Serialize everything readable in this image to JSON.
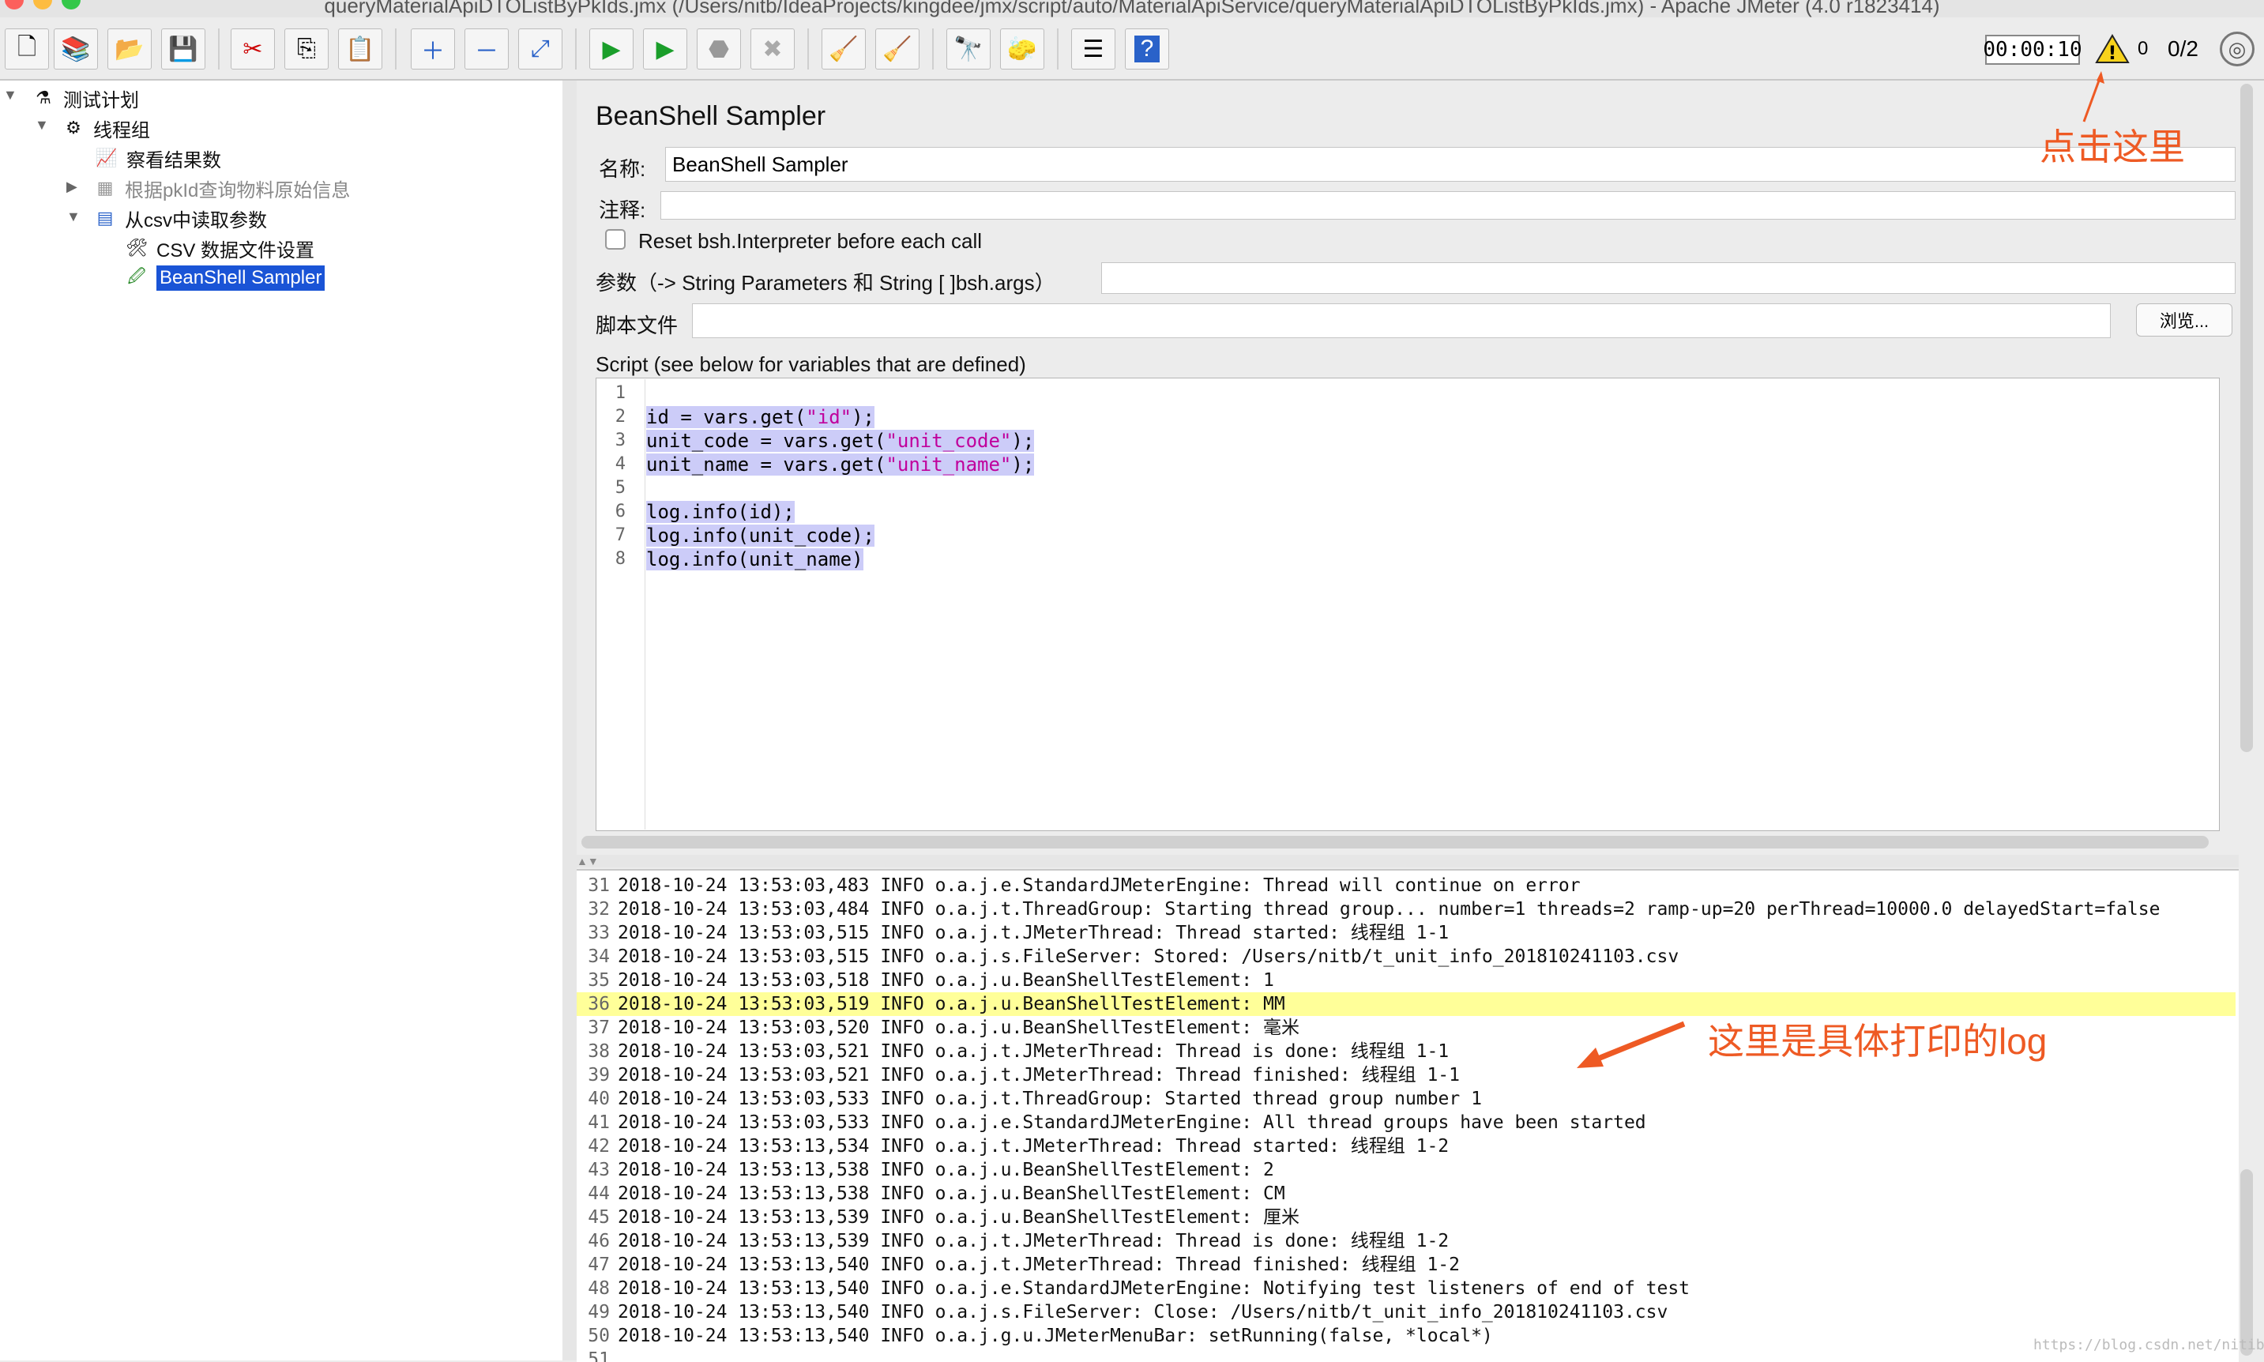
{
  "window": {
    "title": "queryMaterialApiDTOListByPkIds.jmx (/Users/nitb/IdeaProjects/kingdee/jmx/script/auto/MaterialApiService/queryMaterialApiDTOListByPkIds.jmx) - Apache JMeter (4.0 r1823414)"
  },
  "toolbar": {
    "timer": "00:00:10",
    "error_count": "0",
    "thread_count": "0/2"
  },
  "tree": {
    "items": [
      {
        "label": "测试计划"
      },
      {
        "label": "线程组"
      },
      {
        "label": "察看结果数"
      },
      {
        "label": "根据pkId查询物料原始信息"
      },
      {
        "label": "从csv中读取参数"
      },
      {
        "label": "CSV 数据文件设置"
      },
      {
        "label": "BeanShell Sampler"
      }
    ]
  },
  "panel": {
    "heading": "BeanShell Sampler",
    "name_label": "名称:",
    "name_value": "BeanShell Sampler",
    "comment_label": "注释:",
    "reset_label": "Reset bsh.Interpreter before each call",
    "params_label": "参数（-> String Parameters 和 String [ ]bsh.args）",
    "script_file_label": "脚本文件",
    "browse_label": "浏览...",
    "script_label": "Script (see below for variables that are defined)"
  },
  "script": {
    "line_numbers": [
      "1",
      "2",
      "3",
      "4",
      "5",
      "6",
      "7",
      "8"
    ],
    "l2a": "id = vars.get(",
    "l2s": "\"id\"",
    "l2b": ");",
    "l3a": "unit_code = vars.get(",
    "l3s": "\"unit_code\"",
    "l3b": ");",
    "l4a": "unit_name = vars.get(",
    "l4s": "\"unit_name\"",
    "l4b": ");",
    "l6": "log.info(id);",
    "l7": "log.info(unit_code);",
    "l8": "log.info(unit_name)"
  },
  "log": {
    "rows": [
      {
        "n": "31",
        "text": "2018-10-24 13:53:03,483 INFO o.a.j.e.StandardJMeterEngine: Thread will continue on error"
      },
      {
        "n": "32",
        "text": "2018-10-24 13:53:03,484 INFO o.a.j.t.ThreadGroup: Starting thread group... number=1 threads=2 ramp-up=20 perThread=10000.0 delayedStart=false"
      },
      {
        "n": "33",
        "text": "2018-10-24 13:53:03,515 INFO o.a.j.t.JMeterThread: Thread started: 线程组 1-1"
      },
      {
        "n": "34",
        "text": "2018-10-24 13:53:03,515 INFO o.a.j.s.FileServer: Stored: /Users/nitb/t_unit_info_201810241103.csv"
      },
      {
        "n": "35",
        "text": "2018-10-24 13:53:03,518 INFO o.a.j.u.BeanShellTestElement: 1"
      },
      {
        "n": "36",
        "text": "2018-10-24 13:53:03,519 INFO o.a.j.u.BeanShellTestElement: MM"
      },
      {
        "n": "37",
        "text": "2018-10-24 13:53:03,520 INFO o.a.j.u.BeanShellTestElement: 毫米"
      },
      {
        "n": "38",
        "text": "2018-10-24 13:53:03,521 INFO o.a.j.t.JMeterThread: Thread is done: 线程组 1-1"
      },
      {
        "n": "39",
        "text": "2018-10-24 13:53:03,521 INFO o.a.j.t.JMeterThread: Thread finished: 线程组 1-1"
      },
      {
        "n": "40",
        "text": "2018-10-24 13:53:03,533 INFO o.a.j.t.ThreadGroup: Started thread group number 1"
      },
      {
        "n": "41",
        "text": "2018-10-24 13:53:03,533 INFO o.a.j.e.StandardJMeterEngine: All thread groups have been started"
      },
      {
        "n": "42",
        "text": "2018-10-24 13:53:13,534 INFO o.a.j.t.JMeterThread: Thread started: 线程组 1-2"
      },
      {
        "n": "43",
        "text": "2018-10-24 13:53:13,538 INFO o.a.j.u.BeanShellTestElement: 2"
      },
      {
        "n": "44",
        "text": "2018-10-24 13:53:13,538 INFO o.a.j.u.BeanShellTestElement: CM"
      },
      {
        "n": "45",
        "text": "2018-10-24 13:53:13,539 INFO o.a.j.u.BeanShellTestElement: 厘米"
      },
      {
        "n": "46",
        "text": "2018-10-24 13:53:13,539 INFO o.a.j.t.JMeterThread: Thread is done: 线程组 1-2"
      },
      {
        "n": "47",
        "text": "2018-10-24 13:53:13,540 INFO o.a.j.t.JMeterThread: Thread finished: 线程组 1-2"
      },
      {
        "n": "48",
        "text": "2018-10-24 13:53:13,540 INFO o.a.j.e.StandardJMeterEngine: Notifying test listeners of end of test"
      },
      {
        "n": "49",
        "text": "2018-10-24 13:53:13,540 INFO o.a.j.s.FileServer: Close: /Users/nitb/t_unit_info_201810241103.csv"
      },
      {
        "n": "50",
        "text": "2018-10-24 13:53:13,540 INFO o.a.j.g.u.JMeterMenuBar: setRunning(false, *local*)"
      },
      {
        "n": "51",
        "text": ""
      }
    ]
  },
  "annotations": {
    "click_here": "点击这里",
    "log_here": "这里是具体打印的log",
    "watermark": "https://blog.csdn.net/nitibu"
  },
  "colors": {
    "selection": "#1a54d6",
    "annotation": "#ee5a24",
    "log_highlight": "#ffff99",
    "code_highlight": "#ccccf8"
  }
}
